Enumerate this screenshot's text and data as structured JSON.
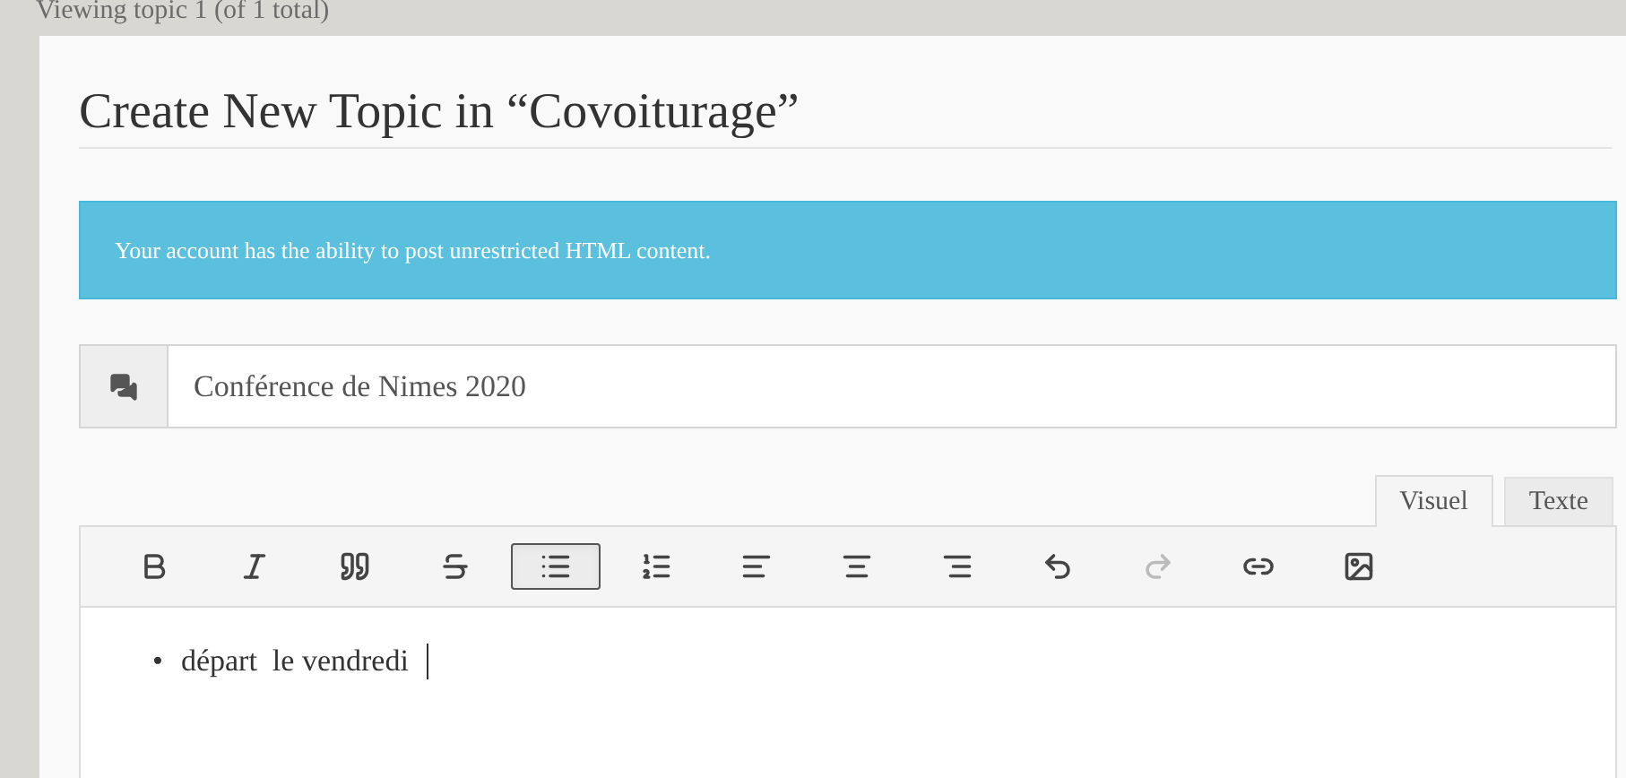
{
  "breadcrumb": "Viewing topic 1 (of 1 total)",
  "form": {
    "title": "Create New Topic in “Covoiturage”",
    "notice": "Your account has the ability to post unrestricted HTML content.",
    "topic_title": {
      "value": "Conférence de Nimes 2020"
    },
    "editor_tabs": [
      {
        "label": "Visuel",
        "selected": true
      },
      {
        "label": "Texte",
        "selected": false
      }
    ],
    "toolbar": [
      {
        "kind": "bold",
        "selected": false,
        "disabled": false
      },
      {
        "kind": "italic",
        "selected": false,
        "disabled": false
      },
      {
        "kind": "quote",
        "selected": false,
        "disabled": false
      },
      {
        "kind": "strikethrough",
        "selected": false,
        "disabled": false
      },
      {
        "kind": "bullet-list",
        "selected": true,
        "disabled": false
      },
      {
        "kind": "numbered-list",
        "selected": false,
        "disabled": false
      },
      {
        "kind": "align-left",
        "selected": false,
        "disabled": false
      },
      {
        "kind": "align-center",
        "selected": false,
        "disabled": false
      },
      {
        "kind": "align-right",
        "selected": false,
        "disabled": false
      },
      {
        "kind": "undo",
        "selected": false,
        "disabled": false
      },
      {
        "kind": "redo",
        "selected": false,
        "disabled": true
      },
      {
        "kind": "link",
        "selected": false,
        "disabled": false
      },
      {
        "kind": "image",
        "selected": false,
        "disabled": false
      }
    ],
    "content": {
      "bullets": [
        {
          "marker": "•",
          "text": "départ  le vendredi"
        }
      ]
    }
  }
}
